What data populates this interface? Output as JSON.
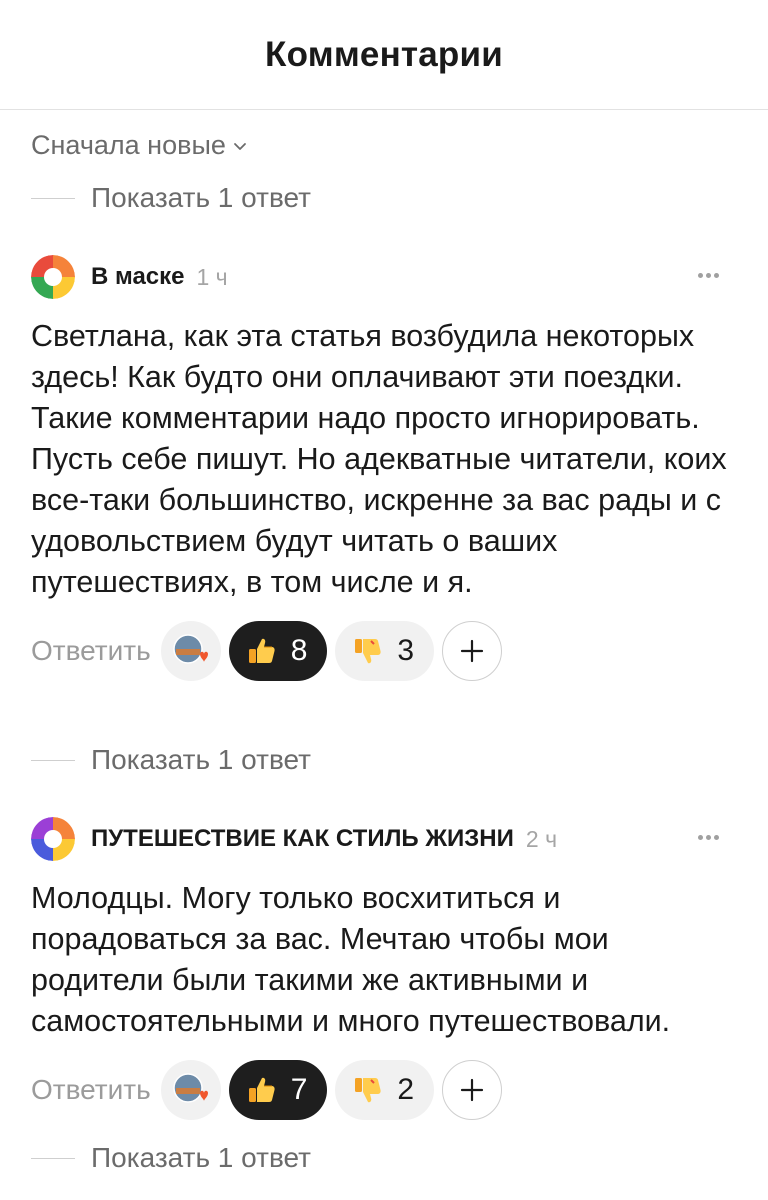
{
  "header": {
    "title": "Комментарии"
  },
  "sort": {
    "label": "Сначала новые"
  },
  "show_replies_label": "Показать 1 ответ",
  "comments": [
    {
      "author": "В маске",
      "time": "1 ч",
      "text": "Светлана, как эта статья возбудила некоторых здесь! Как будто они оплачивают эти поездки. Такие комментарии надо просто игнорировать. Пусть себе пишут. Но адекватные читатели, коих все-таки большинство, искренне за вас рады и с удовольствием будут читать о ваших путешествиях, в том числе и я.",
      "reply_label": "Ответить",
      "likes": "8",
      "dislikes": "3"
    },
    {
      "author": "ПУТЕШЕСТВИЕ КАК СТИЛЬ ЖИЗНИ",
      "time": "2 ч",
      "text": "Молодцы. Могу только восхититься и порадоваться за вас. Мечтаю чтобы мои родители были такими же активными и самостоятельными и много путешествовали.",
      "reply_label": "Ответить",
      "likes": "7",
      "dislikes": "2"
    }
  ],
  "colors": {
    "accent_dark": "#1e1e1e",
    "muted_text": "#6b6b6b",
    "pill_bg": "#f1f1f1"
  },
  "icons": [
    "chevron-down-icon",
    "more-dots-icon",
    "thumbs-up-icon",
    "thumbs-down-icon",
    "plus-icon",
    "heart-icon"
  ]
}
